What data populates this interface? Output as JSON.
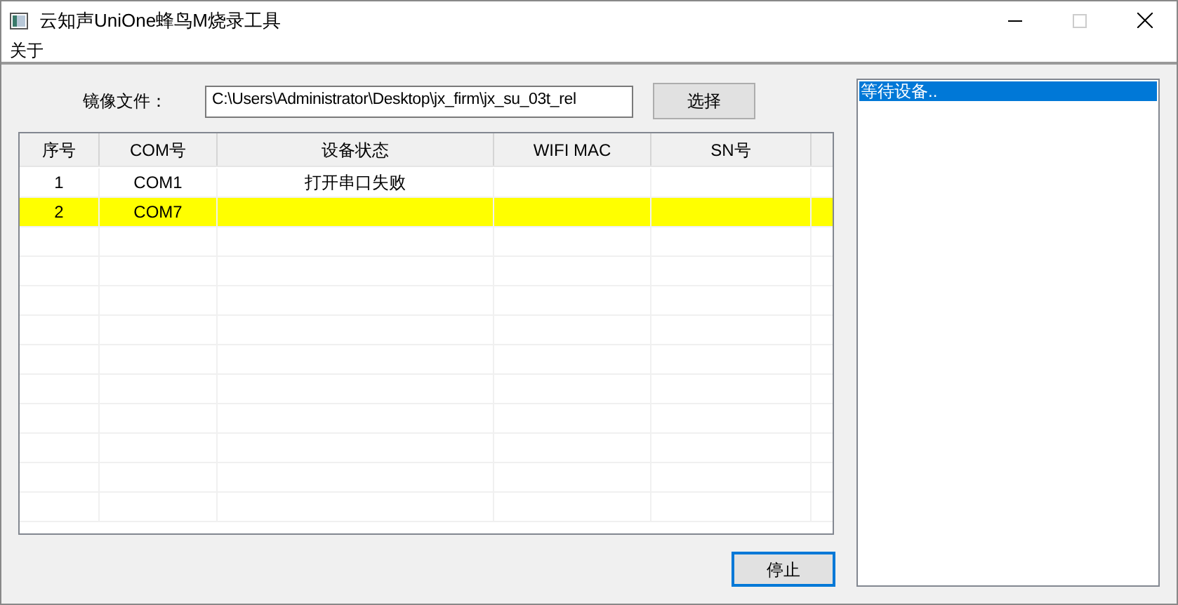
{
  "window": {
    "title": "云知声UniOne蜂鸟M烧录工具"
  },
  "menu": [
    "关于"
  ],
  "image_file": {
    "label": "镜像文件：",
    "value": "C:\\Users\\Administrator\\Desktop\\jx_firm\\jx_su_03t_rel",
    "button": "选择"
  },
  "table": {
    "columns": [
      "序号",
      "COM号",
      "设备状态",
      "WIFI MAC",
      "SN号"
    ],
    "rows": [
      {
        "cells": [
          "1",
          "COM1",
          "打开串口失败",
          "",
          ""
        ],
        "color": "#ffffff"
      },
      {
        "cells": [
          "2",
          "COM7",
          "",
          "",
          ""
        ],
        "color": "#ffff00"
      }
    ]
  },
  "log": [
    {
      "text": "等待设备..",
      "selected": true
    }
  ],
  "stop_button": "停止"
}
